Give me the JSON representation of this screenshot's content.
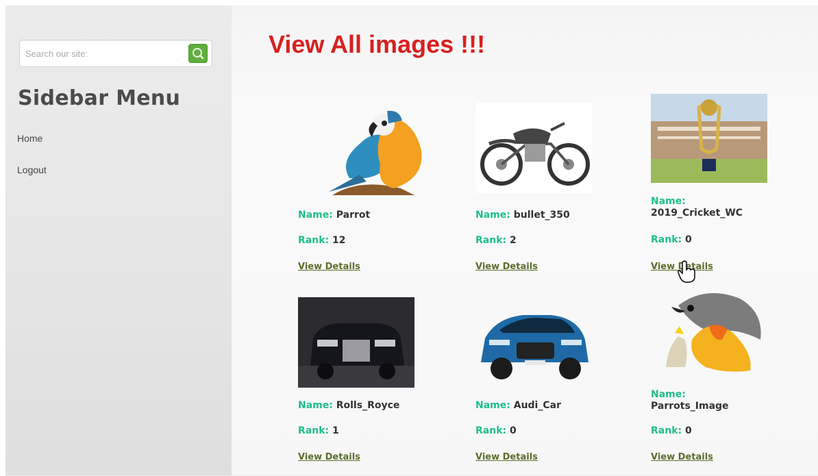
{
  "search": {
    "placeholder": "Search our site:"
  },
  "sidebar": {
    "title": "Sidebar Menu",
    "items": [
      {
        "label": "Home"
      },
      {
        "label": "Logout"
      }
    ]
  },
  "main": {
    "title": "View All images !!!",
    "name_label": "Name:",
    "rank_label": "Rank:",
    "details_label": "View Details",
    "images": [
      {
        "name": "Parrot",
        "rank": "12",
        "thumb": "parrot-image"
      },
      {
        "name": "bullet_350",
        "rank": "2",
        "thumb": "motorcycle-image"
      },
      {
        "name": "2019_Cricket_WC",
        "rank": "0",
        "thumb": "cricket-trophy-image"
      },
      {
        "name": "Rolls_Royce",
        "rank": "1",
        "thumb": "rolls-royce-image"
      },
      {
        "name": "Audi_Car",
        "rank": "0",
        "thumb": "audi-car-image"
      },
      {
        "name": "Parrots_Image",
        "rank": "0",
        "thumb": "parrots-image"
      }
    ]
  },
  "colors": {
    "title_red": "#d82020",
    "label_green": "#1fbf86",
    "search_green": "#5fae3e"
  }
}
